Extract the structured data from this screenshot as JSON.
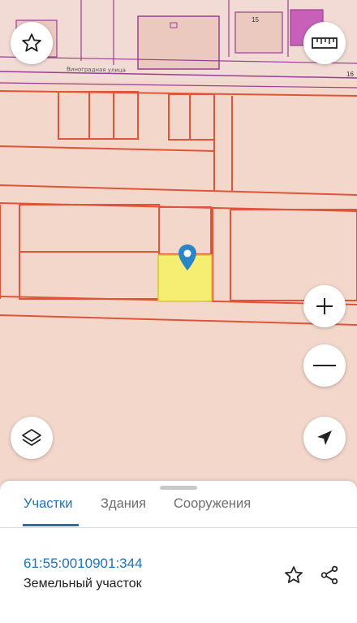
{
  "map": {
    "street_name": "Виноградная улица",
    "building_numbers": [
      "15",
      "16"
    ],
    "colors": {
      "parcel_fill": "#f3d7cb",
      "parcel_outline": "#e0553a",
      "selected_parcel": "#f5ee72",
      "building_outline": "#9a3f93",
      "pin": "#2a86c6"
    },
    "icons": [
      "star-icon",
      "ruler-icon",
      "plus-icon",
      "minus-icon",
      "layers-icon",
      "location-arrow-icon",
      "map-pin-icon"
    ]
  },
  "panel": {
    "tabs": [
      {
        "label": "Участки",
        "active": true
      },
      {
        "label": "Здания",
        "active": false
      },
      {
        "label": "Сооружения",
        "active": false
      }
    ],
    "parcel": {
      "cadastral_number": "61:55:0010901:344",
      "type": "Земельный участок"
    }
  }
}
